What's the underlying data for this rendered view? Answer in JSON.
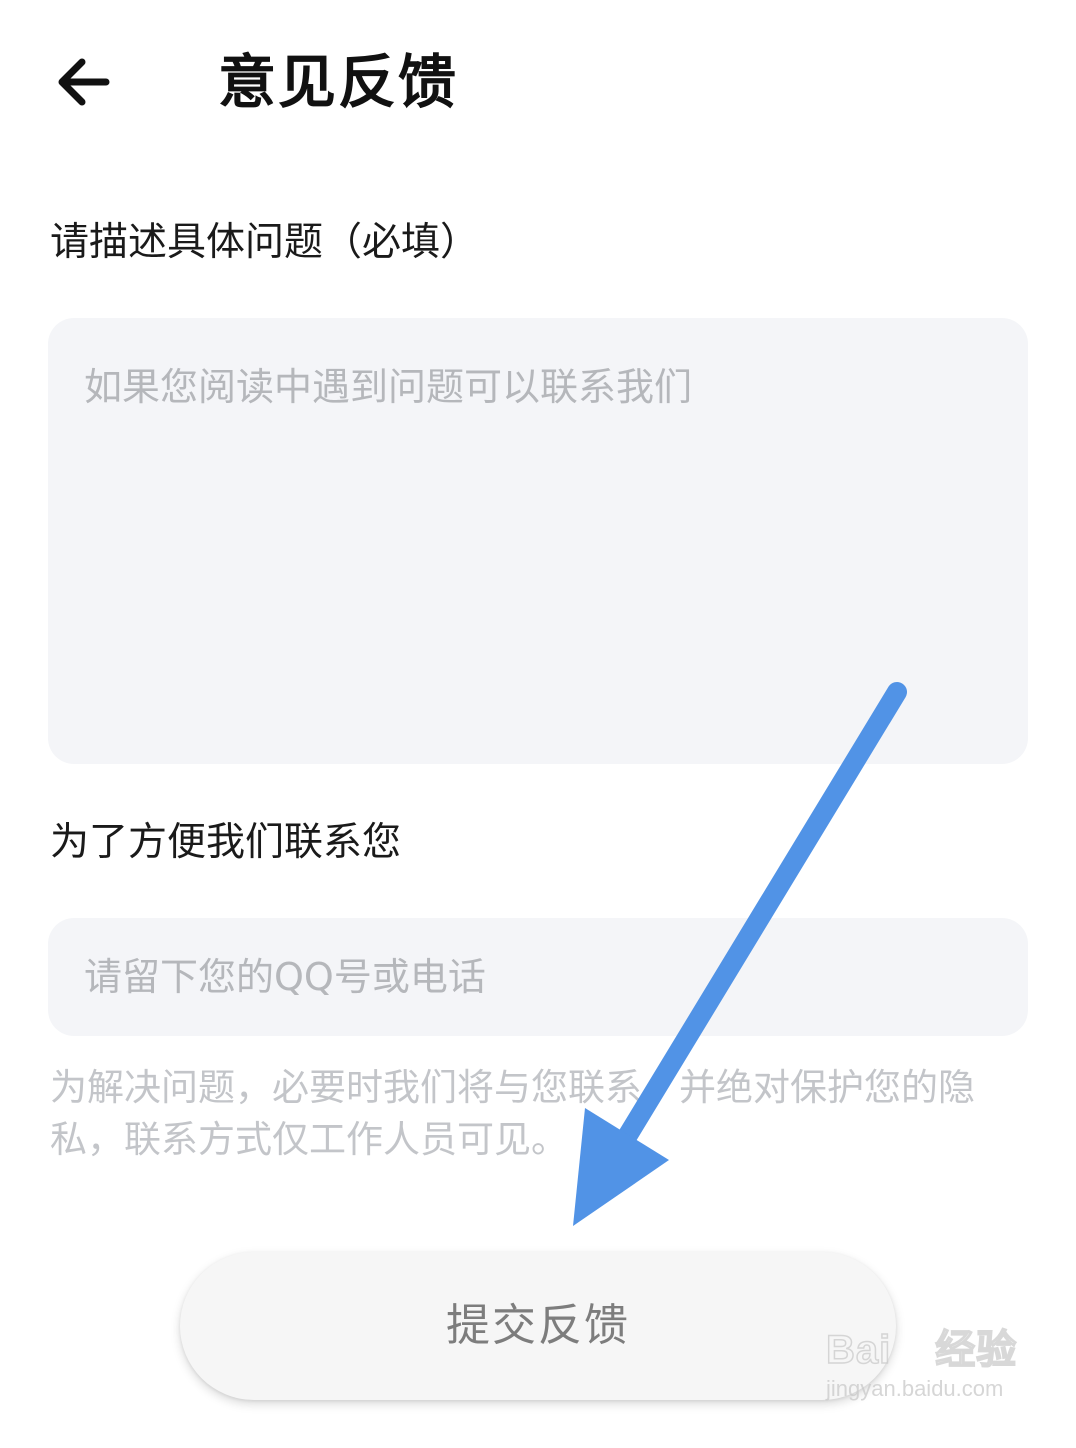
{
  "header": {
    "back_icon": "arrow-left-icon",
    "title": "意见反馈"
  },
  "problem": {
    "label": "请描述具体问题（必填）",
    "placeholder": "如果您阅读中遇到问题可以联系我们",
    "value": ""
  },
  "contact": {
    "label": "为了方便我们联系您",
    "placeholder": "请留下您的QQ号或电话",
    "value": ""
  },
  "privacy_note": "为解决问题，必要时我们将与您联系，并绝对保护您的隐私，联系方式仅工作人员可见。",
  "submit": {
    "label": "提交反馈"
  },
  "annotation": {
    "arrow_color": "#5193e6"
  },
  "watermark": {
    "logo": "Bai du 经验",
    "url": "jingyan.baidu.com"
  },
  "colors": {
    "input_bg": "#f4f5f8",
    "placeholder": "#b5b7bb",
    "note_text": "#c3c5c9",
    "button_text": "#7d7d7d"
  }
}
